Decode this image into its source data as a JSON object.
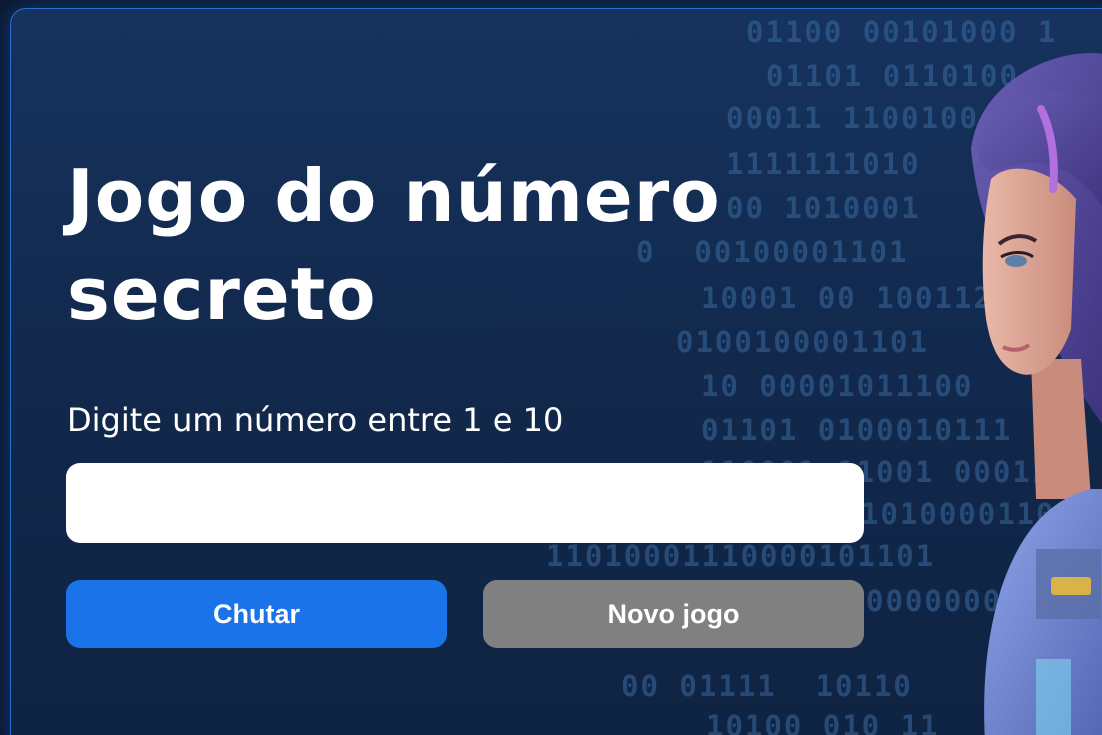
{
  "game": {
    "title": "Jogo do número secreto",
    "prompt": "Digite um número entre 1 e 10",
    "input_value": "",
    "guess_button": "Chutar",
    "new_game_button": "Novo jogo"
  },
  "background": {
    "binary_lines": [
      "01100 00101000 1",
      "01101 0110100",
      "00011 1100100",
      "1111111010",
      "00 1010001",
      "0  00100001101",
      "10001 00 100112",
      "0100100001101",
      "10 00001011100",
      "01101 0100010111",
      "110001 11001 00011",
      "10100001100011",
      "11010001110000101101",
      "00000000011",
      "00 01111  10110",
      "10100 010 11"
    ]
  },
  "colors": {
    "accent": "#1a73e8",
    "secondary_button": "#808080",
    "background": "#12294d",
    "border": "#2b6ed6"
  }
}
